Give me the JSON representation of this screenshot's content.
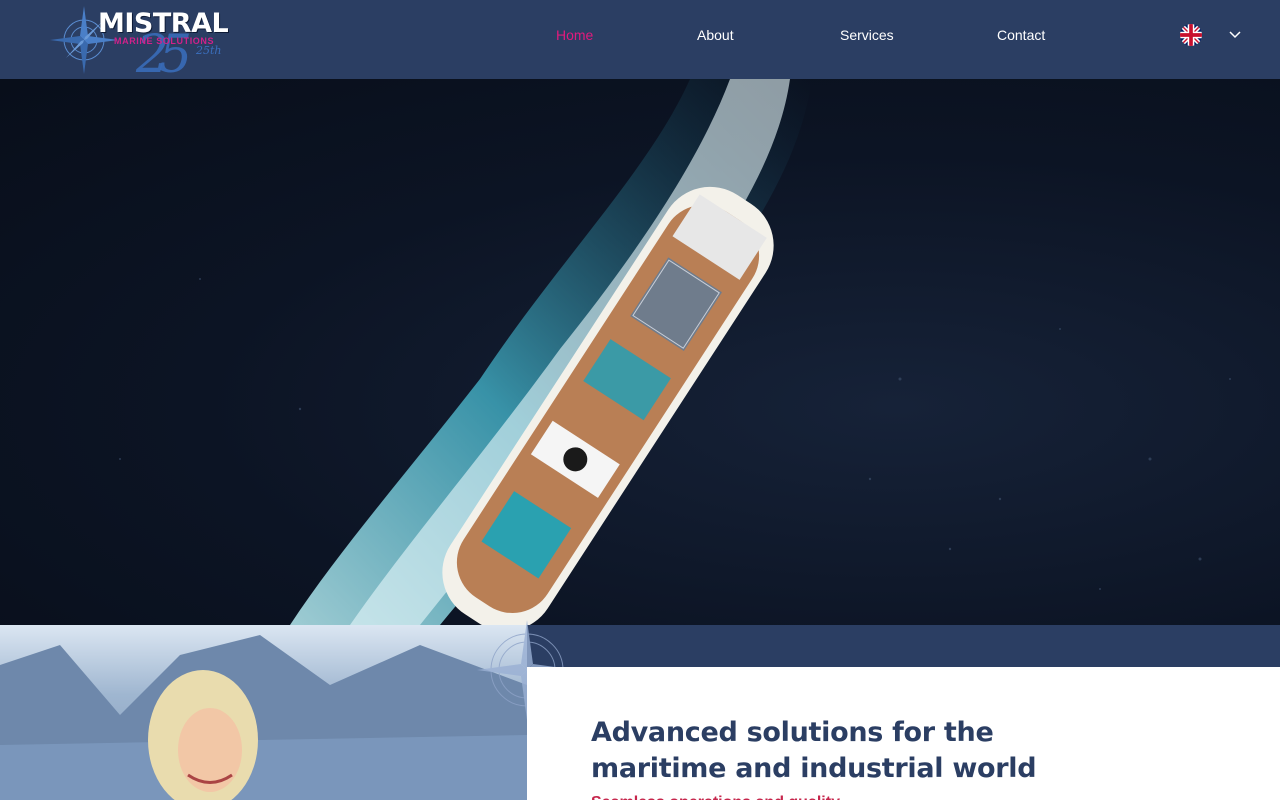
{
  "header": {
    "logo": {
      "main": "MISTRAL",
      "sub": "MARINE SOLUTIONS",
      "badge": "25th"
    },
    "nav": [
      {
        "label": "Home",
        "active": true
      },
      {
        "label": "About",
        "active": false
      },
      {
        "label": "Services",
        "active": false
      },
      {
        "label": "Contact",
        "active": false
      }
    ],
    "language": {
      "flag_icon": "uk-flag-icon",
      "dropdown_icon": "chevron-down-icon"
    }
  },
  "hero": {
    "image": "aerial view of cruise ship sailing on dark sea"
  },
  "intro": {
    "headline": "Advanced solutions for the maritime and industrial world",
    "subline": "Seamless operations and quality"
  },
  "colors": {
    "navy": "#2b3e63",
    "accent_pink": "#e21a7d",
    "text_white": "#ffffff",
    "sea_dark": "#0c1424",
    "wake": "#4fb3c8"
  }
}
